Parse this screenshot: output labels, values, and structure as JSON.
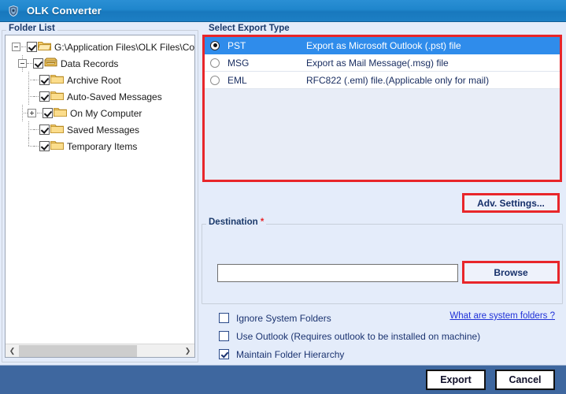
{
  "window": {
    "title": "OLK Converter",
    "icon": "app-shield-icon"
  },
  "folder_list": {
    "group_label": "Folder List",
    "tree": [
      {
        "label": "G:\\Application Files\\OLK Files\\Com",
        "level": 0,
        "checked": true,
        "expander": "minus",
        "icon": "open-folder-icon"
      },
      {
        "label": "Data Records",
        "level": 1,
        "checked": true,
        "expander": "minus",
        "icon": "archive-box-icon"
      },
      {
        "label": "Archive Root",
        "level": 2,
        "checked": true,
        "expander": "none",
        "icon": "folder-icon"
      },
      {
        "label": "Auto-Saved Messages",
        "level": 2,
        "checked": true,
        "expander": "none",
        "icon": "folder-icon"
      },
      {
        "label": "On My Computer",
        "level": 2,
        "checked": true,
        "expander": "plus",
        "icon": "folder-icon"
      },
      {
        "label": "Saved Messages",
        "level": 2,
        "checked": true,
        "expander": "none",
        "icon": "folder-icon"
      },
      {
        "label": "Temporary Items",
        "level": 2,
        "checked": true,
        "expander": "none",
        "icon": "folder-icon"
      }
    ],
    "scrollbar": {
      "left_arrow": "❮",
      "right_arrow": "❯"
    }
  },
  "export_type": {
    "group_label": "Select Export Type",
    "options": [
      {
        "code": "PST",
        "description": "Export as Microsoft Outlook (.pst) file",
        "selected": true
      },
      {
        "code": "MSG",
        "description": "Export as Mail Message(.msg) file",
        "selected": false
      },
      {
        "code": "EML",
        "description": "RFC822 (.eml) file.(Applicable only for mail)",
        "selected": false
      }
    ],
    "highlight_color": "#e8262a"
  },
  "adv_settings": {
    "label": "Adv. Settings..."
  },
  "destination": {
    "group_label": "Destination",
    "required_marker": "*",
    "path_value": "",
    "path_placeholder": "",
    "browse_label": "Browse"
  },
  "options": {
    "items": [
      {
        "label": "Ignore System Folders",
        "checked": false
      },
      {
        "label": "Use Outlook (Requires outlook to be installed on machine)",
        "checked": false
      },
      {
        "label": "Maintain Folder Hierarchy",
        "checked": true
      }
    ],
    "help_link": "What are system folders ?"
  },
  "footer": {
    "export_label": "Export",
    "cancel_label": "Cancel"
  }
}
